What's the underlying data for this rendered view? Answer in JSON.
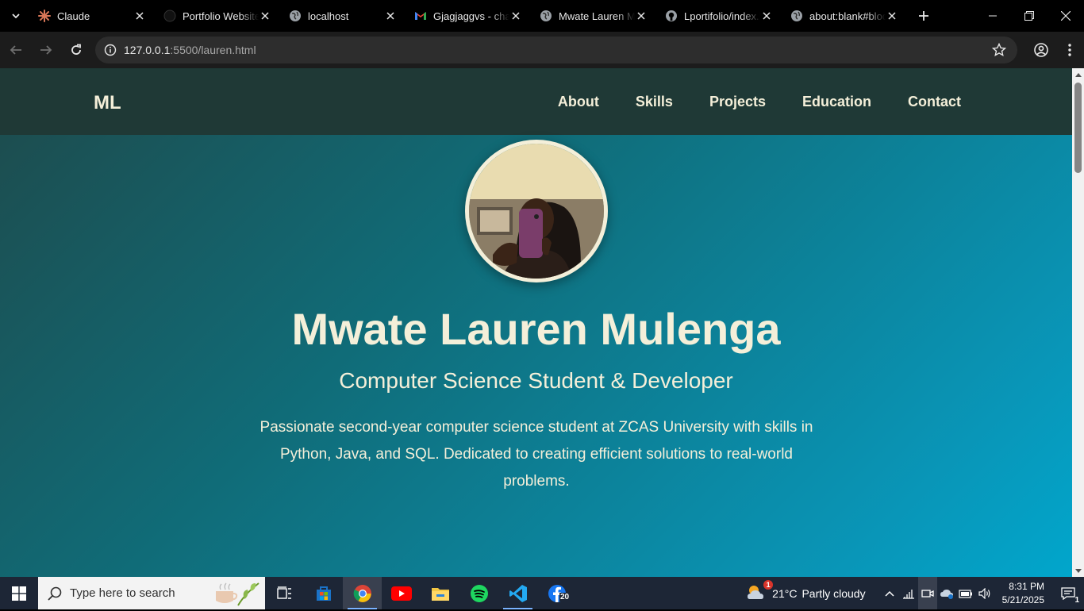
{
  "browser": {
    "tabs": [
      {
        "title": "Claude",
        "icon": "claude-icon"
      },
      {
        "title": "Portfolio Website",
        "icon": "github-dark-icon"
      },
      {
        "title": "localhost",
        "icon": "globe-icon"
      },
      {
        "title": "Gjagjaggvs - chat",
        "icon": "gmail-icon"
      },
      {
        "title": "Mwate Lauren Mulenga",
        "icon": "globe-icon",
        "active": true
      },
      {
        "title": "Lportifolio/index.html",
        "icon": "github-icon"
      },
      {
        "title": "about:blank#blocked",
        "icon": "globe-icon"
      }
    ],
    "url_host": "127.0.0.1",
    "url_rest": ":5500/lauren.html"
  },
  "site": {
    "logo": "ML",
    "nav": [
      "About",
      "Skills",
      "Projects",
      "Education",
      "Contact"
    ],
    "name": "Mwate Lauren Mulenga",
    "subtitle": "Computer Science Student & Developer",
    "description": "Passionate second-year computer science student at ZCAS University with skills in Python, Java, and SQL. Dedicated to creating efficient solutions to real-world problems."
  },
  "taskbar": {
    "search_placeholder": "Type here to search",
    "facebook_badge": "20",
    "weather_badge": "1",
    "temperature": "21°C",
    "weather": "Partly cloudy",
    "time": "8:31 PM",
    "date": "5/21/2025",
    "notification_count": "1"
  },
  "colors": {
    "nav_bg": "#1f3936",
    "hero_start": "#1e4a4b",
    "hero_end": "#01a6cc",
    "cream_text": "#f4efd9",
    "taskbar_bg": "#1d2636"
  }
}
